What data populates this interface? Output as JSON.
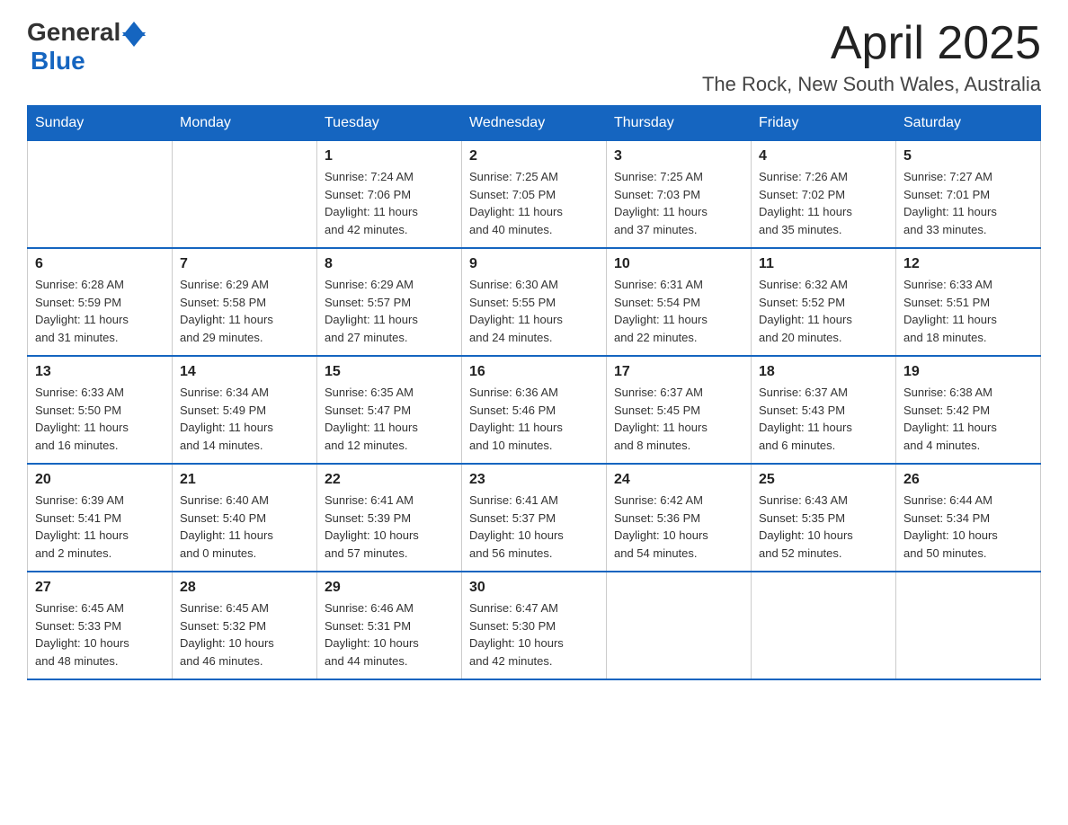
{
  "logo": {
    "text_general": "General",
    "text_blue": "Blue"
  },
  "title": {
    "month_year": "April 2025",
    "location": "The Rock, New South Wales, Australia"
  },
  "weekdays": [
    "Sunday",
    "Monday",
    "Tuesday",
    "Wednesday",
    "Thursday",
    "Friday",
    "Saturday"
  ],
  "weeks": [
    [
      {
        "day": "",
        "info": ""
      },
      {
        "day": "",
        "info": ""
      },
      {
        "day": "1",
        "info": "Sunrise: 7:24 AM\nSunset: 7:06 PM\nDaylight: 11 hours\nand 42 minutes."
      },
      {
        "day": "2",
        "info": "Sunrise: 7:25 AM\nSunset: 7:05 PM\nDaylight: 11 hours\nand 40 minutes."
      },
      {
        "day": "3",
        "info": "Sunrise: 7:25 AM\nSunset: 7:03 PM\nDaylight: 11 hours\nand 37 minutes."
      },
      {
        "day": "4",
        "info": "Sunrise: 7:26 AM\nSunset: 7:02 PM\nDaylight: 11 hours\nand 35 minutes."
      },
      {
        "day": "5",
        "info": "Sunrise: 7:27 AM\nSunset: 7:01 PM\nDaylight: 11 hours\nand 33 minutes."
      }
    ],
    [
      {
        "day": "6",
        "info": "Sunrise: 6:28 AM\nSunset: 5:59 PM\nDaylight: 11 hours\nand 31 minutes."
      },
      {
        "day": "7",
        "info": "Sunrise: 6:29 AM\nSunset: 5:58 PM\nDaylight: 11 hours\nand 29 minutes."
      },
      {
        "day": "8",
        "info": "Sunrise: 6:29 AM\nSunset: 5:57 PM\nDaylight: 11 hours\nand 27 minutes."
      },
      {
        "day": "9",
        "info": "Sunrise: 6:30 AM\nSunset: 5:55 PM\nDaylight: 11 hours\nand 24 minutes."
      },
      {
        "day": "10",
        "info": "Sunrise: 6:31 AM\nSunset: 5:54 PM\nDaylight: 11 hours\nand 22 minutes."
      },
      {
        "day": "11",
        "info": "Sunrise: 6:32 AM\nSunset: 5:52 PM\nDaylight: 11 hours\nand 20 minutes."
      },
      {
        "day": "12",
        "info": "Sunrise: 6:33 AM\nSunset: 5:51 PM\nDaylight: 11 hours\nand 18 minutes."
      }
    ],
    [
      {
        "day": "13",
        "info": "Sunrise: 6:33 AM\nSunset: 5:50 PM\nDaylight: 11 hours\nand 16 minutes."
      },
      {
        "day": "14",
        "info": "Sunrise: 6:34 AM\nSunset: 5:49 PM\nDaylight: 11 hours\nand 14 minutes."
      },
      {
        "day": "15",
        "info": "Sunrise: 6:35 AM\nSunset: 5:47 PM\nDaylight: 11 hours\nand 12 minutes."
      },
      {
        "day": "16",
        "info": "Sunrise: 6:36 AM\nSunset: 5:46 PM\nDaylight: 11 hours\nand 10 minutes."
      },
      {
        "day": "17",
        "info": "Sunrise: 6:37 AM\nSunset: 5:45 PM\nDaylight: 11 hours\nand 8 minutes."
      },
      {
        "day": "18",
        "info": "Sunrise: 6:37 AM\nSunset: 5:43 PM\nDaylight: 11 hours\nand 6 minutes."
      },
      {
        "day": "19",
        "info": "Sunrise: 6:38 AM\nSunset: 5:42 PM\nDaylight: 11 hours\nand 4 minutes."
      }
    ],
    [
      {
        "day": "20",
        "info": "Sunrise: 6:39 AM\nSunset: 5:41 PM\nDaylight: 11 hours\nand 2 minutes."
      },
      {
        "day": "21",
        "info": "Sunrise: 6:40 AM\nSunset: 5:40 PM\nDaylight: 11 hours\nand 0 minutes."
      },
      {
        "day": "22",
        "info": "Sunrise: 6:41 AM\nSunset: 5:39 PM\nDaylight: 10 hours\nand 57 minutes."
      },
      {
        "day": "23",
        "info": "Sunrise: 6:41 AM\nSunset: 5:37 PM\nDaylight: 10 hours\nand 56 minutes."
      },
      {
        "day": "24",
        "info": "Sunrise: 6:42 AM\nSunset: 5:36 PM\nDaylight: 10 hours\nand 54 minutes."
      },
      {
        "day": "25",
        "info": "Sunrise: 6:43 AM\nSunset: 5:35 PM\nDaylight: 10 hours\nand 52 minutes."
      },
      {
        "day": "26",
        "info": "Sunrise: 6:44 AM\nSunset: 5:34 PM\nDaylight: 10 hours\nand 50 minutes."
      }
    ],
    [
      {
        "day": "27",
        "info": "Sunrise: 6:45 AM\nSunset: 5:33 PM\nDaylight: 10 hours\nand 48 minutes."
      },
      {
        "day": "28",
        "info": "Sunrise: 6:45 AM\nSunset: 5:32 PM\nDaylight: 10 hours\nand 46 minutes."
      },
      {
        "day": "29",
        "info": "Sunrise: 6:46 AM\nSunset: 5:31 PM\nDaylight: 10 hours\nand 44 minutes."
      },
      {
        "day": "30",
        "info": "Sunrise: 6:47 AM\nSunset: 5:30 PM\nDaylight: 10 hours\nand 42 minutes."
      },
      {
        "day": "",
        "info": ""
      },
      {
        "day": "",
        "info": ""
      },
      {
        "day": "",
        "info": ""
      }
    ]
  ]
}
